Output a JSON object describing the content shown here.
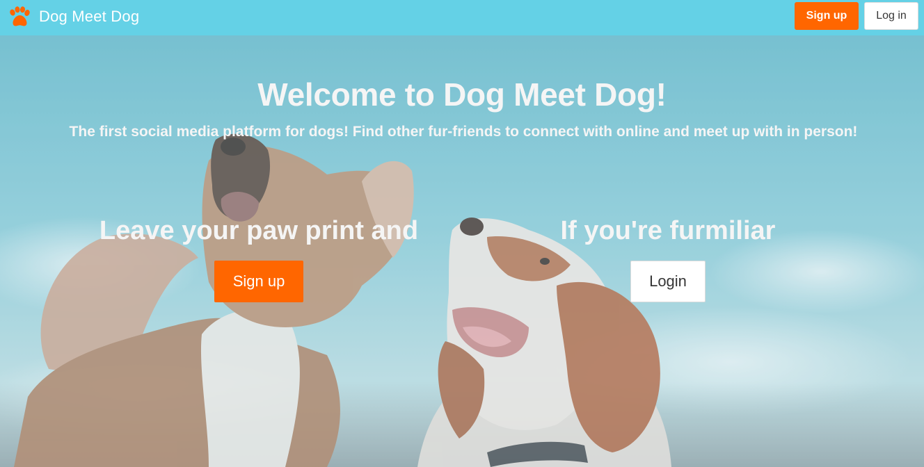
{
  "colors": {
    "navbar_bg": "#64d1e6",
    "accent": "#ff6600",
    "hero_text": "#f5f5f5"
  },
  "navbar": {
    "brand_icon": "paw-icon",
    "brand_name": "Dog Meet Dog",
    "signup_label": "Sign up",
    "login_label": "Log in"
  },
  "hero": {
    "background": "photo-two-dogs-looking-up-blue-sky",
    "title": "Welcome to Dog Meet Dog!",
    "subtitle": "The first social media platform for dogs! Find other fur-friends to connect with online and meet up with in person!",
    "left_heading": "Leave your paw print and",
    "left_button": "Sign up",
    "right_heading": "If you're furmiliar",
    "right_button": "Login"
  }
}
